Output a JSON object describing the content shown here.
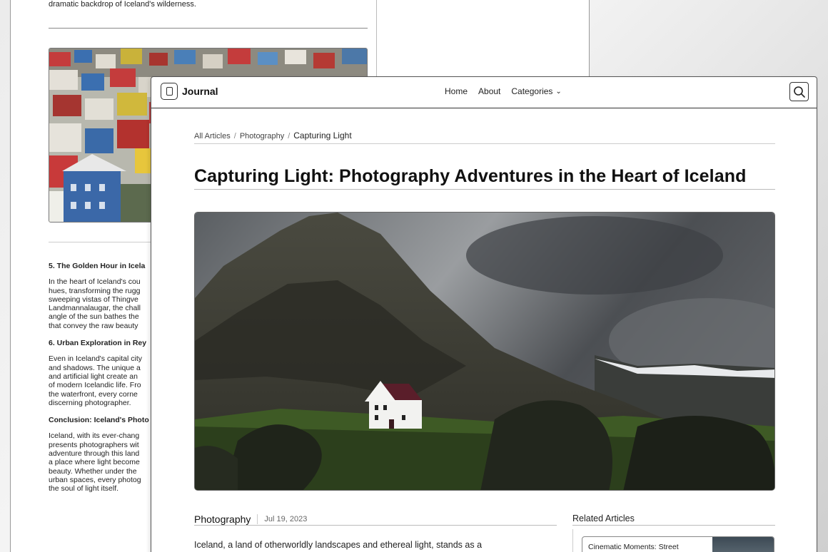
{
  "back_page": {
    "intro_tail": "dramatic backdrop of Iceland's wilderness.",
    "section5_heading": "5. The Golden Hour in Icela",
    "section5_lines": [
      "In the heart of Iceland's cou",
      "hues, transforming the rugg",
      "sweeping vistas of Thingve",
      "Landmannalaugar, the chall",
      "angle of the sun bathes the",
      "that convey the raw beauty"
    ],
    "section6_heading": "6. Urban Exploration in Rey",
    "section6_lines": [
      "Even in Iceland's capital city",
      "and shadows. The unique a",
      "and artificial light create an",
      "of modern Icelandic life. Fro",
      "the waterfront, every corne",
      "discerning photographer."
    ],
    "conclusion_heading": "Conclusion: Iceland's Photo",
    "conclusion_lines": [
      "Iceland, with its ever-chang",
      "presents photographers wit",
      "adventure through this land",
      "a place where light become",
      "beauty. Whether under the",
      "urban spaces, every photog",
      "the soul of light itself."
    ]
  },
  "nav": {
    "logo": "Journal",
    "links": [
      "Home",
      "About",
      "Categories"
    ]
  },
  "breadcrumb": [
    "All Articles",
    "Photography",
    "Capturing Light"
  ],
  "article": {
    "title": "Capturing Light: Photography Adventures in the Heart of Iceland",
    "category": "Photography",
    "date": "Jul 19, 2023",
    "intro": "Iceland, a land of otherworldly landscapes and ethereal light, stands as a"
  },
  "related": {
    "heading": "Related Articles",
    "cards": [
      "Cinematic Moments: Street"
    ]
  }
}
